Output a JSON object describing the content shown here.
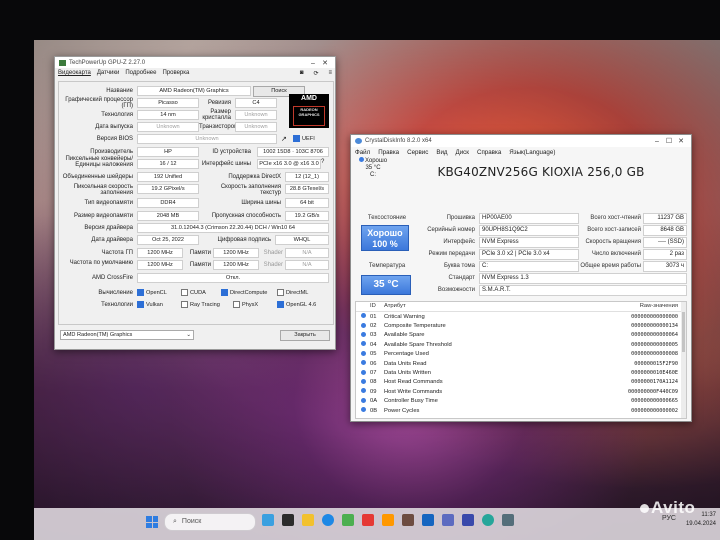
{
  "gpuz": {
    "title": "TechPowerUp GPU-Z 2.27.0",
    "menu": [
      "Видеокарта",
      "Датчики",
      "Подробнее",
      "Проверка"
    ],
    "lookup_button": "Поиск",
    "fields": {
      "name_label": "Название",
      "name": "AMD Radeon(TM) Graphics",
      "gpu_label": "Графический процессор (ГП)",
      "gpu": "Picasso",
      "revision_label": "Ревизия",
      "revision": "C4",
      "tech_label": "Технология",
      "tech": "14 nm",
      "die_label": "Размер кристалла",
      "die": "Unknown",
      "release_label": "Дата выпуска",
      "release": "Unknown",
      "trans_label": "Транзисторов",
      "trans": "Unknown",
      "bios_label": "Версия BIOS",
      "bios": "Unknown",
      "uefi": "UEFI",
      "vendor_label": "Производитель",
      "vendor": "HP",
      "devid_label": "ID устройства",
      "devid": "1002 15D8 · 103C 8706",
      "rops_label": "Пиксельные конвейеры/ Единицы наложения",
      "rops": "16 / 12",
      "bus_label": "Интерфейс шины",
      "bus": "PCIe x16 3.0 @ x16 3.0",
      "shaders_label": "Объединенные шейдеры",
      "shaders": "192 Unified",
      "dx_label": "Поддержка DirectX",
      "dx": "12 (12_1)",
      "pixfill_label": "Пиксельная скорость заполнения",
      "pixfill": "19.2 GPixel/s",
      "texfill_label": "Скорость заполнения текстур",
      "texfill": "28.8 GTexel/s",
      "memtype_label": "Тип видеопамяти",
      "memtype": "DDR4",
      "buswidth_label": "Ширина шины",
      "buswidth": "64 bit",
      "memsize_label": "Размер видеопамяти",
      "memsize": "2048 MB",
      "bandwidth_label": "Пропускная способность",
      "bandwidth": "19.2 GB/s",
      "driver_label": "Версия драйвера",
      "driver": "31.0.12044.3 (Crimson 22.20.44) DCH / Win10 64",
      "driverdate_label": "Дата драйвера",
      "driverdate": "Oct 25, 2022",
      "sig_label": "Цифровая подпись",
      "sig": "WHQL",
      "gpuclock_label": "Частота ГП",
      "gpuclock": "1200 MHz",
      "memclock_label": "Памяти",
      "memclock": "1200 MHz",
      "shader_label": "Shader",
      "shader": "N/A",
      "defclock_label": "Частота по умолчанию",
      "defclock": "1200 MHz",
      "defmem_label": "Памяти",
      "defmem": "1200 MHz",
      "defshader_label": "Shader",
      "defshader": "N/A",
      "crossfire_label": "AMD CrossFire",
      "crossfire": "Откл.",
      "compute_label": "Вычисление",
      "tech2_label": "Технологии"
    },
    "compute": [
      {
        "name": "OpenCL",
        "on": true
      },
      {
        "name": "CUDA",
        "on": false
      },
      {
        "name": "DirectCompute",
        "on": true
      },
      {
        "name": "DirectML",
        "on": false
      }
    ],
    "technologies": [
      {
        "name": "Vulkan",
        "on": true
      },
      {
        "name": "Ray Tracing",
        "on": false
      },
      {
        "name": "PhysX",
        "on": false
      },
      {
        "name": "OpenGL 4.6",
        "on": true
      }
    ],
    "selected_card": "AMD Radeon(TM) Graphics",
    "close_button": "Закрыть",
    "logo_text": "AMD",
    "logo_sub": "RADEON GRAPHICS"
  },
  "cdi": {
    "title": "CrystalDiskInfo 8.2.0 x64",
    "menu": [
      "Файл",
      "Правка",
      "Сервис",
      "Вид",
      "Диск",
      "Справка",
      "Язык(Language)"
    ],
    "strip_status": "Хорошо",
    "strip_temp": "35 °C",
    "strip_drive": "C:",
    "drive_title": "KBG40ZNV256G KIOXIA 256,0 GB",
    "health_label": "Техсостояние",
    "health_value": "Хорошо",
    "health_pct": "100 %",
    "temp_label": "Температура",
    "temp_value": "35 °C",
    "info": {
      "fw_label": "Прошивка",
      "fw": "HP00AE00",
      "sn_label": "Серийный номер",
      "sn": "90UPH8S1Q9C2",
      "iface_label": "Интерфейс",
      "iface": "NVM Express",
      "mode_label": "Режим передачи",
      "mode": "PCIe 3.0 x2 | PCIe 3.0 x4",
      "letter_label": "Буква тома",
      "letter": "C:",
      "std_label": "Стандарт",
      "std": "NVM Express 1.3",
      "feat_label": "Возможности",
      "feat": "S.M.A.R.T.",
      "reads_label": "Всего хост-чтений",
      "reads": "11237 GB",
      "writes_label": "Всего хост-записей",
      "writes": "8648 GB",
      "rpm_label": "Скорость вращения",
      "rpm": "---- (SSD)",
      "power_label": "Число включений",
      "power": "2 раз",
      "hours_label": "Общее время работы",
      "hours": "3073 ч"
    },
    "smart_headers": {
      "id": "ID",
      "attr": "Атрибут",
      "raw": "Raw-значения"
    },
    "smart": [
      {
        "id": "01",
        "name": "Critical Warning",
        "raw": "000000000000000"
      },
      {
        "id": "02",
        "name": "Composite Temperature",
        "raw": "000000000000134"
      },
      {
        "id": "03",
        "name": "Available Spare",
        "raw": "000000000000064"
      },
      {
        "id": "04",
        "name": "Available Spare Threshold",
        "raw": "000000000000005"
      },
      {
        "id": "05",
        "name": "Percentage Used",
        "raw": "000000000000008"
      },
      {
        "id": "06",
        "name": "Data Units Read",
        "raw": "000000015F2F90"
      },
      {
        "id": "07",
        "name": "Data Units Written",
        "raw": "0000000010E460E"
      },
      {
        "id": "08",
        "name": "Host Read Commands",
        "raw": "0000000170A1124"
      },
      {
        "id": "09",
        "name": "Host Write Commands",
        "raw": "000000000F440C09"
      },
      {
        "id": "0A",
        "name": "Controller Busy Time",
        "raw": "000000000000665"
      },
      {
        "id": "0B",
        "name": "Power Cycles",
        "raw": "000000000000002"
      }
    ]
  },
  "taskbar": {
    "search_placeholder": "Поиск",
    "time": "11:37",
    "date": "19.04.2024",
    "lang": "РУС"
  },
  "watermark": "Avito"
}
